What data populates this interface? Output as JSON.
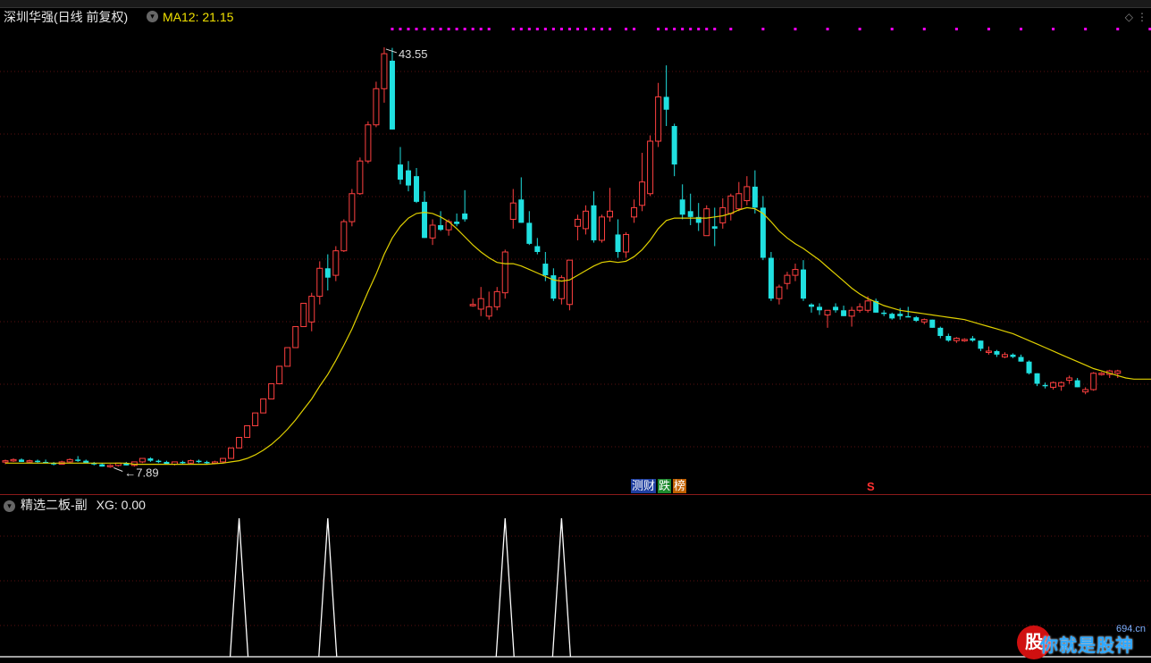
{
  "header": {
    "stock_title": "深圳华强(日线 前复权)",
    "dropdown_icon": "chevron-down-icon",
    "ma_label": "MA12: 21.15",
    "corner_icon": "diamond-icon"
  },
  "sub": {
    "indicator_title": "精选二板-副",
    "xg_label": "XG: 0.00"
  },
  "labels": {
    "high_label": "43.55",
    "low_label": "7.89"
  },
  "badges": [
    "测财",
    "跌",
    "榜"
  ],
  "s_mark": "S",
  "watermark": {
    "text": "你就是股神",
    "site": "694.cn"
  },
  "colors": {
    "up": "#ff4040",
    "down": "#20e0e0",
    "ma": "#e0d000",
    "dots": "#ff00ff",
    "signal": "#ffffff",
    "grid": "#5a1010"
  },
  "chart_data": {
    "type": "candlestick",
    "ma_period": 12,
    "ylim": [
      7,
      45
    ],
    "candles": [
      [
        8.0,
        8.2,
        7.8,
        8.1
      ],
      [
        8.1,
        8.3,
        8.0,
        8.2
      ],
      [
        8.2,
        8.3,
        8.0,
        8.0
      ],
      [
        8.0,
        8.2,
        7.9,
        8.1
      ],
      [
        8.1,
        8.2,
        7.9,
        8.0
      ],
      [
        8.0,
        8.2,
        7.9,
        7.9
      ],
      [
        7.9,
        8.0,
        7.7,
        7.8
      ],
      [
        7.8,
        8.1,
        7.8,
        8.0
      ],
      [
        8.0,
        8.3,
        7.9,
        8.2
      ],
      [
        8.2,
        8.5,
        8.0,
        8.1
      ],
      [
        8.1,
        8.2,
        7.9,
        7.9
      ],
      [
        7.9,
        8.0,
        7.7,
        7.8
      ],
      [
        7.8,
        7.9,
        7.6,
        7.6
      ],
      [
        7.6,
        7.8,
        7.5,
        7.7
      ],
      [
        7.7,
        7.9,
        7.6,
        7.9
      ],
      [
        7.9,
        8.0,
        7.7,
        7.7
      ],
      [
        7.7,
        8.0,
        7.6,
        8.0
      ],
      [
        8.0,
        8.3,
        7.9,
        8.3
      ],
      [
        8.3,
        8.4,
        8.0,
        8.1
      ],
      [
        8.1,
        8.2,
        7.9,
        8.0
      ],
      [
        8.0,
        8.1,
        7.8,
        7.8
      ],
      [
        7.8,
        8.0,
        7.7,
        8.0
      ],
      [
        8.0,
        8.1,
        7.8,
        7.9
      ],
      [
        7.9,
        8.2,
        7.8,
        8.1
      ],
      [
        8.1,
        8.2,
        7.9,
        8.0
      ],
      [
        8.0,
        8.1,
        7.8,
        7.9
      ],
      [
        7.9,
        8.1,
        7.8,
        8.0
      ],
      [
        8.0,
        8.3,
        7.9,
        8.3
      ],
      [
        8.3,
        9.2,
        8.3,
        9.2
      ],
      [
        9.2,
        10.1,
        9.2,
        10.1
      ],
      [
        10.1,
        11.1,
        10.1,
        11.1
      ],
      [
        11.1,
        12.2,
        11.1,
        12.2
      ],
      [
        12.2,
        13.4,
        12.2,
        13.4
      ],
      [
        13.4,
        14.7,
        13.4,
        14.7
      ],
      [
        14.7,
        16.2,
        14.7,
        16.2
      ],
      [
        16.2,
        17.8,
        16.2,
        17.8
      ],
      [
        17.8,
        19.6,
        17.8,
        19.6
      ],
      [
        19.6,
        21.6,
        19.6,
        21.6
      ],
      [
        20.0,
        22.5,
        19.2,
        22.2
      ],
      [
        22.2,
        25.2,
        21.5,
        24.6
      ],
      [
        24.6,
        25.8,
        22.7,
        23.8
      ],
      [
        24.0,
        26.5,
        23.5,
        26.1
      ],
      [
        26.1,
        28.8,
        26.0,
        28.6
      ],
      [
        28.6,
        31.4,
        28.2,
        31.0
      ],
      [
        31.0,
        34.1,
        30.9,
        33.8
      ],
      [
        33.8,
        37.2,
        33.6,
        36.9
      ],
      [
        36.9,
        40.6,
        36.7,
        40.0
      ],
      [
        40.0,
        43.55,
        38.8,
        43.0
      ],
      [
        42.4,
        43.5,
        36.5,
        36.5
      ],
      [
        33.5,
        35.0,
        31.8,
        32.2
      ],
      [
        33.0,
        33.8,
        31.2,
        31.7
      ],
      [
        32.5,
        33.2,
        30.2,
        30.3
      ],
      [
        30.3,
        31.2,
        27.2,
        27.2
      ],
      [
        27.2,
        28.8,
        26.6,
        28.3
      ],
      [
        28.3,
        29.5,
        27.8,
        27.9
      ],
      [
        27.9,
        28.8,
        27.4,
        28.6
      ],
      [
        28.6,
        29.3,
        28.2,
        28.4
      ],
      [
        29.3,
        31.3,
        28.6,
        28.8
      ],
      [
        21.5,
        22.0,
        21.3,
        21.5
      ],
      [
        21.1,
        23.0,
        20.5,
        22.0
      ],
      [
        20.5,
        22.6,
        20.2,
        21.3
      ],
      [
        21.3,
        23.0,
        21.0,
        22.6
      ],
      [
        22.5,
        26.2,
        22.0,
        26.0
      ],
      [
        28.8,
        31.4,
        28.0,
        30.2
      ],
      [
        30.5,
        32.4,
        28.5,
        28.5
      ],
      [
        28.5,
        29.5,
        26.6,
        26.7
      ],
      [
        26.5,
        27.2,
        25.8,
        26.0
      ],
      [
        25.0,
        26.0,
        23.5,
        24.0
      ],
      [
        24.0,
        24.6,
        21.8,
        22.0
      ],
      [
        22.0,
        24.0,
        21.5,
        23.8
      ],
      [
        21.5,
        23.4,
        21.0,
        25.3
      ],
      [
        28.2,
        29.2,
        27.0,
        28.8
      ],
      [
        28.0,
        30.0,
        27.5,
        29.5
      ],
      [
        30.0,
        31.2,
        26.8,
        27.0
      ],
      [
        27.0,
        29.2,
        26.8,
        29.0
      ],
      [
        29.0,
        31.5,
        28.6,
        29.5
      ],
      [
        27.5,
        28.8,
        25.5,
        26.0
      ],
      [
        26.0,
        27.7,
        25.5,
        27.5
      ],
      [
        29.0,
        30.5,
        28.5,
        29.8
      ],
      [
        30.0,
        34.5,
        29.5,
        32.0
      ],
      [
        31.0,
        36.0,
        30.8,
        35.5
      ],
      [
        35.5,
        40.5,
        35.0,
        39.3
      ],
      [
        39.3,
        42.0,
        36.8,
        38.2
      ],
      [
        36.8,
        37.0,
        32.5,
        33.5
      ],
      [
        30.5,
        31.8,
        28.8,
        29.2
      ],
      [
        29.5,
        31.0,
        28.3,
        29.0
      ],
      [
        29.0,
        30.2,
        27.8,
        28.5
      ],
      [
        27.4,
        30.0,
        27.4,
        29.7
      ],
      [
        28.2,
        29.8,
        26.5,
        28.0
      ],
      [
        28.5,
        30.6,
        28.0,
        29.8
      ],
      [
        29.3,
        31.0,
        28.7,
        30.8
      ],
      [
        29.7,
        32.0,
        29.5,
        31.0
      ],
      [
        30.4,
        32.5,
        30.0,
        31.6
      ],
      [
        31.6,
        33.0,
        29.3,
        29.8
      ],
      [
        29.8,
        30.8,
        25.3,
        25.5
      ],
      [
        25.5,
        26.0,
        21.8,
        22.0
      ],
      [
        22.0,
        23.2,
        21.5,
        23.0
      ],
      [
        23.3,
        24.3,
        22.8,
        24.0
      ],
      [
        24.0,
        25.0,
        23.5,
        24.5
      ],
      [
        24.5,
        25.3,
        21.8,
        22.0
      ],
      [
        21.5,
        21.6,
        20.8,
        21.3
      ],
      [
        21.3,
        21.6,
        20.6,
        21.0
      ],
      [
        20.6,
        21.0,
        19.5,
        21.0
      ],
      [
        21.3,
        21.6,
        20.8,
        21.0
      ],
      [
        21.0,
        21.4,
        20.5,
        20.5
      ],
      [
        20.5,
        21.3,
        19.6,
        21.0
      ],
      [
        21.0,
        21.6,
        20.8,
        21.3
      ],
      [
        21.0,
        22.2,
        20.8,
        21.8
      ],
      [
        21.8,
        22.0,
        20.8,
        20.8
      ],
      [
        20.8,
        21.0,
        20.5,
        20.7
      ],
      [
        20.7,
        20.8,
        20.2,
        20.3
      ],
      [
        20.7,
        21.2,
        20.2,
        20.5
      ],
      [
        20.5,
        21.3,
        20.4,
        20.4
      ],
      [
        20.4,
        20.5,
        20.0,
        20.1
      ],
      [
        20.0,
        20.3,
        19.8,
        20.2
      ],
      [
        20.2,
        20.2,
        19.5,
        19.5
      ],
      [
        19.5,
        19.6,
        18.6,
        18.8
      ],
      [
        18.8,
        19.0,
        18.3,
        18.4
      ],
      [
        18.4,
        18.7,
        18.2,
        18.6
      ],
      [
        18.4,
        18.6,
        18.3,
        18.5
      ],
      [
        18.6,
        18.8,
        18.3,
        18.4
      ],
      [
        18.4,
        18.4,
        17.5,
        17.7
      ],
      [
        17.4,
        17.9,
        17.2,
        17.5
      ],
      [
        17.5,
        17.6,
        17.0,
        17.2
      ],
      [
        17.0,
        17.4,
        16.9,
        17.2
      ],
      [
        17.2,
        17.3,
        16.9,
        17.0
      ],
      [
        17.0,
        17.2,
        16.6,
        16.6
      ],
      [
        16.6,
        16.7,
        15.5,
        15.6
      ],
      [
        15.6,
        15.6,
        14.5,
        14.7
      ],
      [
        14.6,
        14.8,
        14.3,
        14.5
      ],
      [
        14.4,
        14.9,
        14.2,
        14.8
      ],
      [
        14.5,
        14.9,
        14.1,
        14.8
      ],
      [
        15.0,
        15.4,
        14.7,
        15.2
      ],
      [
        15.0,
        15.2,
        14.4,
        14.4
      ],
      [
        14.0,
        14.4,
        13.8,
        14.2
      ],
      [
        14.2,
        15.7,
        14.1,
        15.6
      ],
      [
        15.6,
        15.7,
        15.4,
        15.6
      ],
      [
        15.5,
        15.9,
        15.2,
        15.8
      ],
      [
        15.6,
        15.9,
        15.2,
        15.8
      ]
    ],
    "ma_values": [
      7.9,
      7.9,
      7.9,
      7.9,
      7.9,
      7.9,
      7.9,
      7.9,
      7.9,
      7.9,
      7.9,
      7.9,
      7.9,
      7.9,
      7.9,
      7.9,
      7.8,
      7.8,
      7.8,
      7.8,
      7.8,
      7.8,
      7.8,
      7.8,
      7.8,
      7.8,
      7.85,
      7.9,
      8.0,
      8.1,
      8.3,
      8.6,
      9.0,
      9.5,
      10.1,
      10.8,
      11.6,
      12.5,
      13.4,
      14.5,
      15.5,
      16.7,
      18.0,
      19.4,
      21.0,
      22.6,
      24.1,
      25.8,
      27.2,
      28.2,
      28.9,
      29.3,
      29.4,
      29.3,
      29.0,
      28.6,
      28.0,
      27.3,
      26.6,
      26.0,
      25.5,
      25.1,
      25.0,
      25.0,
      24.8,
      24.5,
      24.2,
      23.9,
      23.6,
      23.5,
      23.6,
      24.0,
      24.4,
      24.8,
      25.1,
      25.2,
      25.1,
      25.2,
      25.6,
      26.2,
      27.0,
      28.0,
      28.7,
      28.9,
      28.9,
      28.9,
      28.9,
      28.9,
      29.0,
      29.1,
      29.3,
      29.6,
      29.8,
      29.7,
      29.3,
      28.6,
      27.8,
      27.2,
      26.7,
      26.3,
      25.8,
      25.3,
      24.7,
      24.1,
      23.5,
      22.9,
      22.4,
      22.0,
      21.7,
      21.4,
      21.2,
      21.0,
      20.9,
      20.8,
      20.7,
      20.6,
      20.5,
      20.4,
      20.3,
      20.2,
      20.0,
      19.8,
      19.6,
      19.4,
      19.2,
      19.0,
      18.7,
      18.4,
      18.1,
      17.8,
      17.5,
      17.2,
      16.9,
      16.6,
      16.3,
      16.0,
      15.8,
      15.6,
      15.4,
      15.2,
      15.1,
      15.1,
      15.1,
      15.1
    ],
    "dot_marks": [
      48,
      49,
      50,
      51,
      52,
      53,
      54,
      55,
      56,
      57,
      58,
      59,
      60,
      63,
      64,
      65,
      66,
      67,
      68,
      69,
      70,
      71,
      72,
      73,
      74,
      75,
      77,
      78,
      81,
      82,
      83,
      84,
      85,
      86,
      87,
      88,
      90,
      94,
      98,
      102,
      106,
      110,
      114,
      118,
      122,
      126,
      130,
      134,
      138,
      142
    ],
    "signal": {
      "title": "精选二板-副",
      "xg": 0.0,
      "peaks": [
        29,
        40,
        62,
        69
      ]
    }
  }
}
